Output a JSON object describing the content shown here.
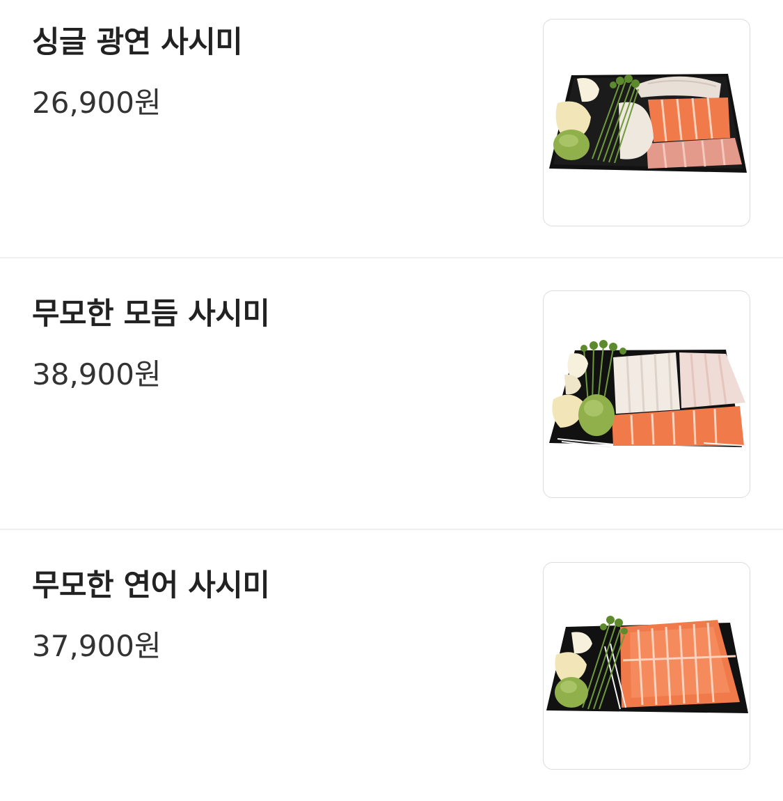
{
  "menu": {
    "items": [
      {
        "name": "싱글 광연 사시미",
        "price": "26,900원",
        "image": "single-sashimi-platter"
      },
      {
        "name": "무모한 모듬 사시미",
        "price": "38,900원",
        "image": "assorted-sashimi-platter"
      },
      {
        "name": "무모한 연어 사시미",
        "price": "37,900원",
        "image": "salmon-sashimi-platter"
      }
    ]
  },
  "colors": {
    "text": "#222222",
    "price": "#333333",
    "divider": "#f0f0f0",
    "thumb_border": "#dcdcdc",
    "tray": "#111111",
    "salmon": "#f07a4a",
    "white_fish": "#eee6da",
    "wasabi": "#8fb04a",
    "ginger": "#f2e6b8",
    "sprouts": "#6f9a3a"
  }
}
